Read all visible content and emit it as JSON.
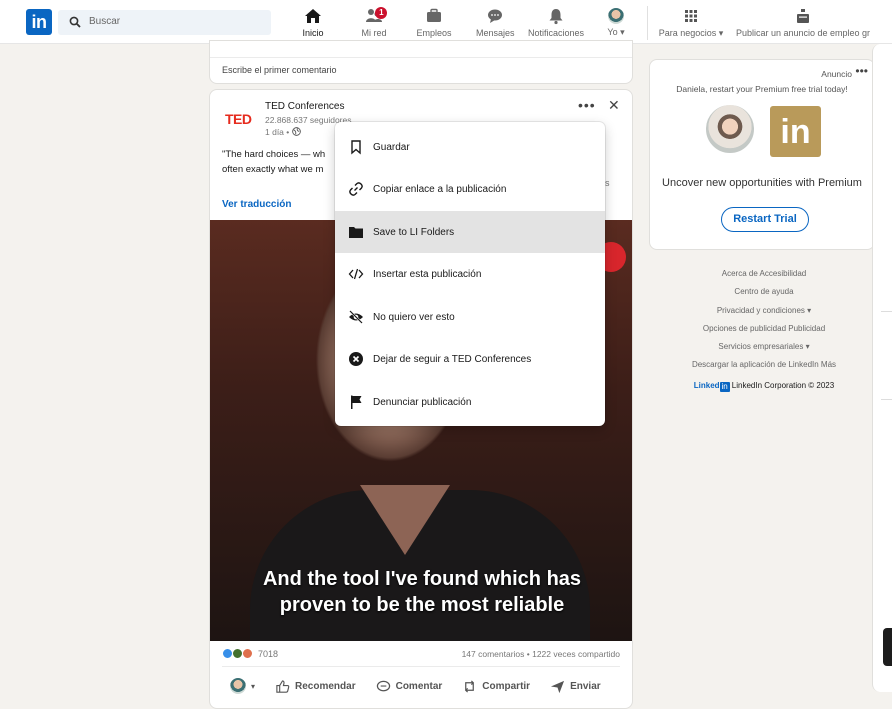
{
  "nav": {
    "search_placeholder": "Buscar",
    "items": [
      {
        "label": "Inicio"
      },
      {
        "label": "Mi red",
        "badge": "1"
      },
      {
        "label": "Empleos"
      },
      {
        "label": "Mensajes"
      },
      {
        "label": "Notificaciones"
      },
      {
        "label": "Yo ▾"
      },
      {
        "label": "Para negocios ▾"
      },
      {
        "label": "Publicar un anuncio de empleo gr"
      }
    ]
  },
  "feed": {
    "first_comment": "Escribe el primer comentario",
    "post": {
      "author": "TED Conferences",
      "followers": "22.868.637 seguidores",
      "time": "1 día •",
      "text": "\"The hard choices — wh",
      "text2": "often exactly what we m",
      "see_more": "ás",
      "translate": "Ver traducción",
      "caption_line1": "And the tool I've found which has",
      "caption_line2": "proven to be the most reliable",
      "reactions_count": "7018",
      "stats": "147 comentarios • 1222 veces compartido",
      "actions": {
        "recommend": "Recomendar",
        "comment": "Comentar",
        "share": "Compartir",
        "send": "Enviar"
      }
    }
  },
  "menu": {
    "items": [
      {
        "label": "Guardar",
        "icon": "bookmark-icon"
      },
      {
        "label": "Copiar enlace a la publicación",
        "icon": "link-icon"
      },
      {
        "label": "Save to LI Folders",
        "icon": "folder-icon"
      },
      {
        "label": "Insertar esta publicación",
        "icon": "code-icon"
      },
      {
        "label": "No quiero ver esto",
        "icon": "eye-off-icon"
      },
      {
        "label": "Dejar de seguir a TED Conferences",
        "icon": "close-circle-icon"
      },
      {
        "label": "Denunciar publicación",
        "icon": "flag-icon"
      }
    ]
  },
  "ad": {
    "label": "Anuncio",
    "tagline": "Daniela, restart your Premium free trial today!",
    "body": "Uncover new opportunities with Premium",
    "button": "Restart Trial"
  },
  "footer": {
    "links": [
      "Acerca de     Accesibilidad",
      "Centro de ayuda",
      "Privacidad y condiciones ▾",
      "Opciones de publicidad   Publicidad",
      "Servicios empresariales ▾",
      "Descargar la aplicación de LinkedIn   Más"
    ],
    "brand_word": "Linked",
    "brand_in": "in",
    "copyright": "LinkedIn Corporation © 2023"
  },
  "colors": {
    "brand": "#0a66c2",
    "ted_red": "#e62b1e",
    "premium_gold": "#b99a5a",
    "badge_red": "#cb112d"
  }
}
